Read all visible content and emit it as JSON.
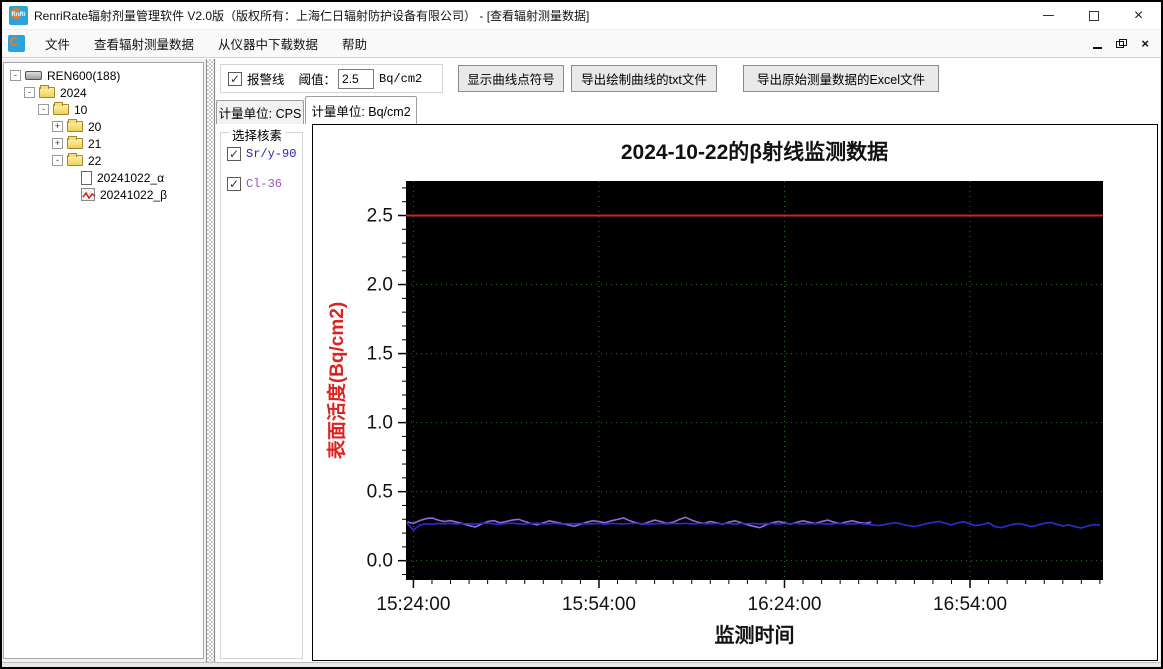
{
  "window": {
    "title": "RenriRate辐射剂量管理软件 V2.0版（版权所有：上海仁日辐射防护设备有限公司） - [查看辐射测量数据]",
    "controls": {
      "minimize": "minimize",
      "maximize": "maximize",
      "close": "×"
    }
  },
  "menu": {
    "items": [
      "文件",
      "查看辐射测量数据",
      "从仪器中下载数据",
      "帮助"
    ],
    "child_controls": {
      "minimize": "minimize",
      "restore": "restore",
      "close": "×"
    }
  },
  "tree": {
    "items": [
      {
        "label": "REN600(188)",
        "level": 0,
        "expander": "-",
        "icon": "device"
      },
      {
        "label": "2024",
        "level": 1,
        "expander": "-",
        "icon": "folder"
      },
      {
        "label": "10",
        "level": 2,
        "expander": "-",
        "icon": "folder"
      },
      {
        "label": "20",
        "level": 3,
        "expander": "+",
        "icon": "folder"
      },
      {
        "label": "21",
        "level": 3,
        "expander": "+",
        "icon": "folder"
      },
      {
        "label": "22",
        "level": 3,
        "expander": "-",
        "icon": "folder"
      },
      {
        "label": "20241022_α",
        "level": 4,
        "expander": "none",
        "icon": "doc"
      },
      {
        "label": "20241022_β",
        "level": 4,
        "expander": "none",
        "icon": "chart"
      }
    ]
  },
  "toolbar": {
    "alarm_label": "报警线",
    "alarm_checked": true,
    "threshold_label": "阈值：",
    "threshold_value": "2.5",
    "threshold_unit": "Bq/cm2",
    "buttons": [
      "显示曲线点符号",
      "导出绘制曲线的txt文件",
      "导出原始测量数据的Excel文件"
    ]
  },
  "tabs": [
    {
      "label": "计量单位: CPS",
      "selected": false
    },
    {
      "label": "计量单位: Bq/cm2",
      "selected": true
    }
  ],
  "nuclide_panel": {
    "title": "选择核素",
    "items": [
      {
        "label": "Sr/y-90",
        "checked": true,
        "color": "#2525a8"
      },
      {
        "label": "Cl-36",
        "checked": true,
        "color": "#9b4fc8"
      }
    ]
  },
  "chart_data": {
    "type": "line",
    "title": "2024-10-22的β射线监测数据",
    "xlabel": "监测时间",
    "ylabel": "表面活度(Bq/cm2)",
    "plot_bg": "#000000",
    "grid_color": "#1e7a1e",
    "grid_on": true,
    "ylim": [
      -0.14,
      2.75
    ],
    "xlim_minutes": [
      -1.2,
      111.5
    ],
    "x_base_time": "15:24:00",
    "x_major_ticks": [
      {
        "minute": 0,
        "label": "15:24:00"
      },
      {
        "minute": 30,
        "label": "15:54:00"
      },
      {
        "minute": 60,
        "label": "16:24:00"
      },
      {
        "minute": 90,
        "label": "16:54:00"
      }
    ],
    "x_minor_step_minutes": 3,
    "y_major_ticks": [
      0.0,
      0.5,
      1.0,
      1.5,
      2.0,
      2.5
    ],
    "y_minor_step": 0.1,
    "alarm_line": {
      "value": 2.5,
      "color": "#cc2222"
    },
    "axis_label_color": "#dd2222",
    "series": [
      {
        "name": "Sr/y-90",
        "color": "#2a2fd4",
        "t0_minute": -1,
        "dt_minutes": 1,
        "values": [
          0.27,
          0.222,
          0.258,
          0.268,
          0.264,
          0.27,
          0.267,
          0.271,
          0.265,
          0.269,
          0.267,
          0.265,
          0.27,
          0.272,
          0.267,
          0.264,
          0.269,
          0.272,
          0.267,
          0.265,
          0.27,
          0.271,
          0.266,
          0.268,
          0.27,
          0.265,
          0.269,
          0.267,
          0.271,
          0.266,
          0.268,
          0.27,
          0.265,
          0.27,
          0.268,
          0.266,
          0.269,
          0.271,
          0.267,
          0.265,
          0.268,
          0.27,
          0.266,
          0.269,
          0.267,
          0.271,
          0.265,
          0.269,
          0.268,
          0.266,
          0.27,
          0.267,
          0.269,
          0.265,
          0.271,
          0.267,
          0.269,
          0.266,
          0.268,
          0.27,
          0.265,
          0.269,
          0.267,
          0.271,
          0.266,
          0.269,
          0.267,
          0.27,
          0.265,
          0.268,
          0.271,
          0.266,
          0.267,
          0.269,
          0.266,
          0.261,
          0.254,
          0.259,
          0.269,
          0.274,
          0.264,
          0.254,
          0.247,
          0.257,
          0.269,
          0.277,
          0.284,
          0.271,
          0.259,
          0.274,
          0.282,
          0.267,
          0.254,
          0.261,
          0.274,
          0.247,
          0.239,
          0.251,
          0.264,
          0.269,
          0.257,
          0.246,
          0.259,
          0.271,
          0.277,
          0.264,
          0.252,
          0.259,
          0.246,
          0.237,
          0.251,
          0.261,
          0.258
        ]
      },
      {
        "name": "Cl-36",
        "color": "#9a66dd",
        "t0_minute": -1,
        "dt_minutes": 1,
        "values": [
          0.28,
          0.27,
          0.29,
          0.304,
          0.31,
          0.294,
          0.284,
          0.29,
          0.279,
          0.268,
          0.254,
          0.244,
          0.264,
          0.284,
          0.29,
          0.274,
          0.284,
          0.294,
          0.3,
          0.284,
          0.269,
          0.259,
          0.274,
          0.289,
          0.279,
          0.269,
          0.259,
          0.249,
          0.264,
          0.279,
          0.289,
          0.284,
          0.274,
          0.289,
          0.299,
          0.309,
          0.289,
          0.274,
          0.264,
          0.279,
          0.294,
          0.284,
          0.269,
          0.279,
          0.299,
          0.314,
          0.294,
          0.279,
          0.269,
          0.284,
          0.274,
          0.264,
          0.279,
          0.289,
          0.274,
          0.259,
          0.249,
          0.239,
          0.259,
          0.274,
          0.284,
          0.274,
          0.264,
          0.279,
          0.289,
          0.279,
          0.269,
          0.284,
          0.294,
          0.279,
          0.269,
          0.281,
          0.289,
          0.277,
          0.271,
          0.279
        ]
      }
    ]
  }
}
